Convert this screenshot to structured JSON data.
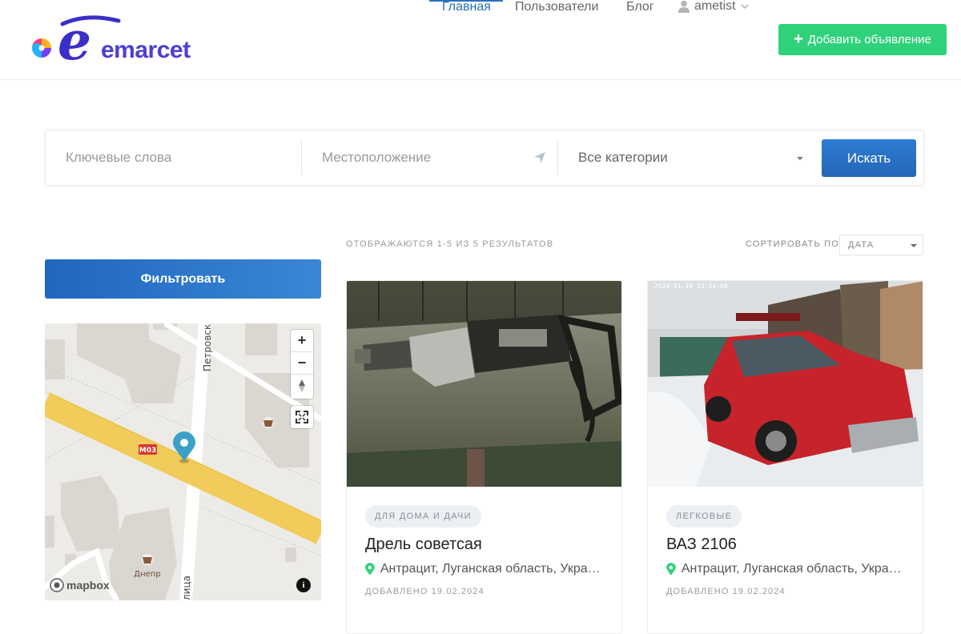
{
  "header": {
    "logo_text": "emarcet",
    "nav": {
      "home": "Главная",
      "users": "Пользователи",
      "blog": "Блог",
      "user": "ametist"
    },
    "add_button": "Добавить объявление"
  },
  "search": {
    "keywords_placeholder": "Ключевые слова",
    "location_placeholder": "Местоположение",
    "category": "Все категории",
    "button": "Искать"
  },
  "sidebar": {
    "filter_button": "Фильтровать",
    "map": {
      "street_vertical": "Петровск",
      "street_bottom": "лица",
      "road_badge": "М03",
      "poi_label": "Днепр",
      "attribution": "mapbox",
      "info": "i"
    }
  },
  "results": {
    "count_text": "ОТОБРАЖАЮТСЯ 1-5 ИЗ 5 РЕЗУЛЬТАТОВ",
    "sort_label": "СОРТИРОВАТЬ ПО",
    "sort_value": "ДАТА",
    "cards": [
      {
        "tag": "ДЛЯ ДОМА И ДАЧИ",
        "title": "Дрель советсая",
        "location": "Антрацит, Луганская область, Украина",
        "date": "ДОБАВЛЕНО 19.02.2024",
        "image": "drill-photo"
      },
      {
        "tag": "ЛЕГКОВЫЕ",
        "title": "ВАЗ 2106",
        "location": "Антрацит, Луганская область, Украина",
        "date": "ДОБАВЛЕНО 19.02.2024",
        "photo_timestamp": "2024-01-16 13:34:08",
        "image": "red-car-photo"
      }
    ]
  },
  "colors": {
    "accent": "#2a6fc1",
    "add_button": "#2fd27b",
    "pin": "#2fd27b",
    "map_pin": "#3aa0c8"
  }
}
